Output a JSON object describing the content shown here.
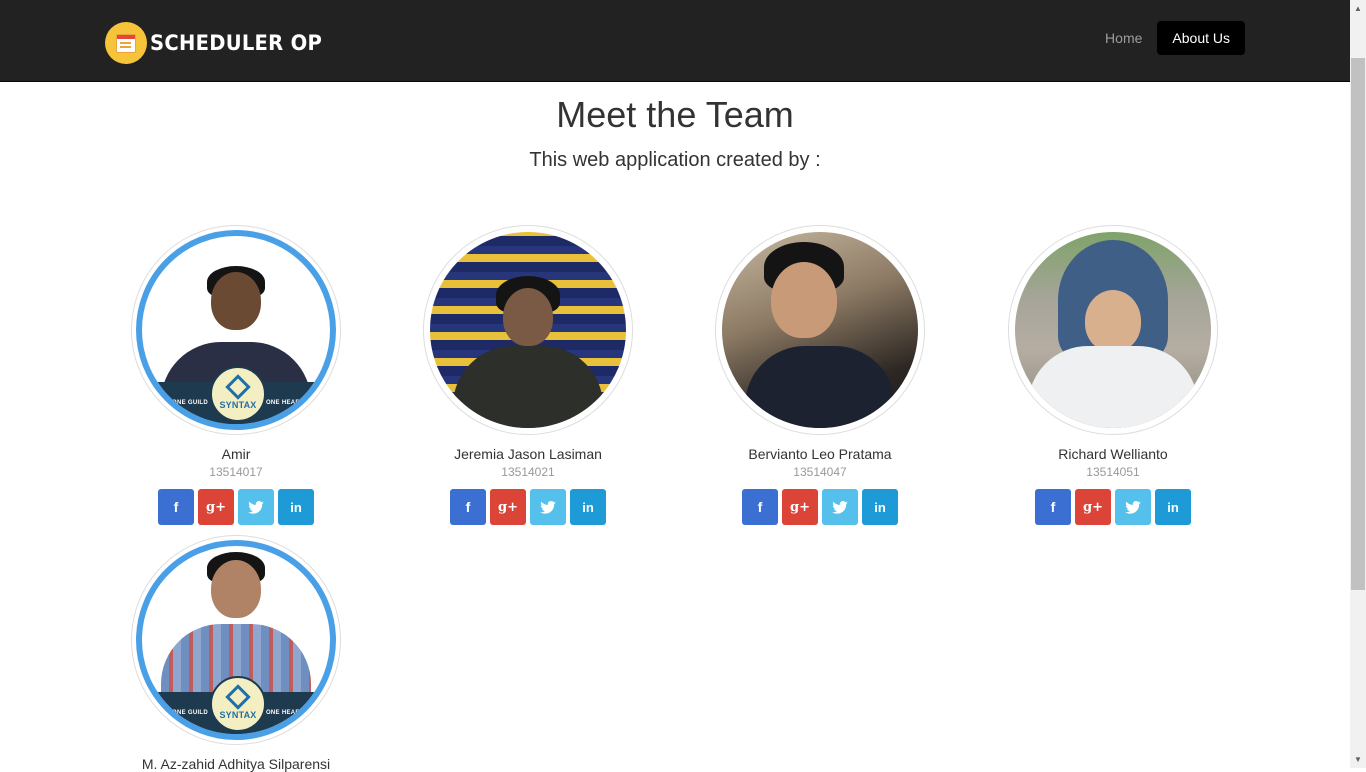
{
  "brand": {
    "name": "SCHEDULER OP",
    "logo_icon": "calendar-icon"
  },
  "nav": {
    "items": [
      {
        "label": "Home",
        "active": false
      },
      {
        "label": "About Us",
        "active": true
      }
    ]
  },
  "header": {
    "title": "Meet the Team",
    "subtitle": "This web application created by :"
  },
  "team": [
    {
      "name": "Amir",
      "nim": "13514017",
      "photo_badge": {
        "left": "ONE GUILD",
        "right": "ONE HEART",
        "logo": "SYNTAX"
      }
    },
    {
      "name": "Jeremia Jason Lasiman",
      "nim": "13514021"
    },
    {
      "name": "Bervianto Leo Pratama",
      "nim": "13514047"
    },
    {
      "name": "Richard Wellianto",
      "nim": "13514051"
    },
    {
      "name": "M. Az-zahid Adhitya Silparensi",
      "nim": "",
      "photo_badge": {
        "left": "ONE GUILD",
        "right": "ONE HEART",
        "logo": "SYNTAX"
      }
    }
  ],
  "social": {
    "facebook": "f",
    "google_plus": "g+",
    "twitter": "twitter-bird",
    "linkedin": "in"
  },
  "colors": {
    "navbar": "#222222",
    "facebook": "#3b6fd1",
    "google_plus": "#db4437",
    "twitter": "#55c0ec",
    "linkedin": "#1e9ad6",
    "ring": "#4aa0e6"
  }
}
